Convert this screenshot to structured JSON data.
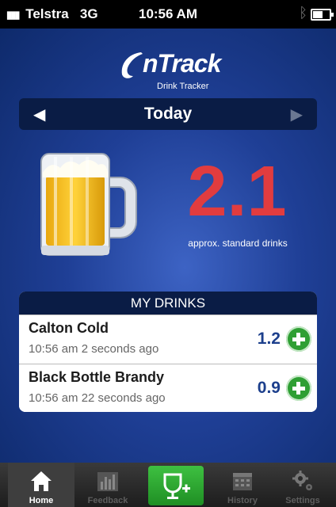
{
  "status": {
    "carrier": "Telstra",
    "network": "3G",
    "time": "10:56 AM"
  },
  "app": {
    "logo_text": "nTrack",
    "logo_subtitle": "Drink Tracker"
  },
  "date_nav": {
    "label": "Today",
    "prev_icon": "left-triangle-icon",
    "next_icon": "right-triangle-icon"
  },
  "summary": {
    "total": "2.1",
    "caption": "approx. standard drinks"
  },
  "my_drinks": {
    "title": "MY DRINKS",
    "items": [
      {
        "name": "Calton Cold",
        "time": "10:56 am 2 seconds ago",
        "amount": "1.2"
      },
      {
        "name": "Black Bottle Brandy",
        "time": "10:56 am 22 seconds ago",
        "amount": "0.9"
      }
    ]
  },
  "tabs": [
    {
      "label": "Home",
      "icon": "home-icon",
      "active": true
    },
    {
      "label": "Feedback",
      "icon": "bar-chart-icon",
      "active": false
    },
    {
      "label": "",
      "icon": "add-drink-icon",
      "active": false
    },
    {
      "label": "History",
      "icon": "calendar-icon",
      "active": false
    },
    {
      "label": "Settings",
      "icon": "gears-icon",
      "active": false
    }
  ],
  "colors": {
    "accent_red": "#e13c3f",
    "add_green": "#2f9f34",
    "amount_blue": "#1c3f8c"
  }
}
